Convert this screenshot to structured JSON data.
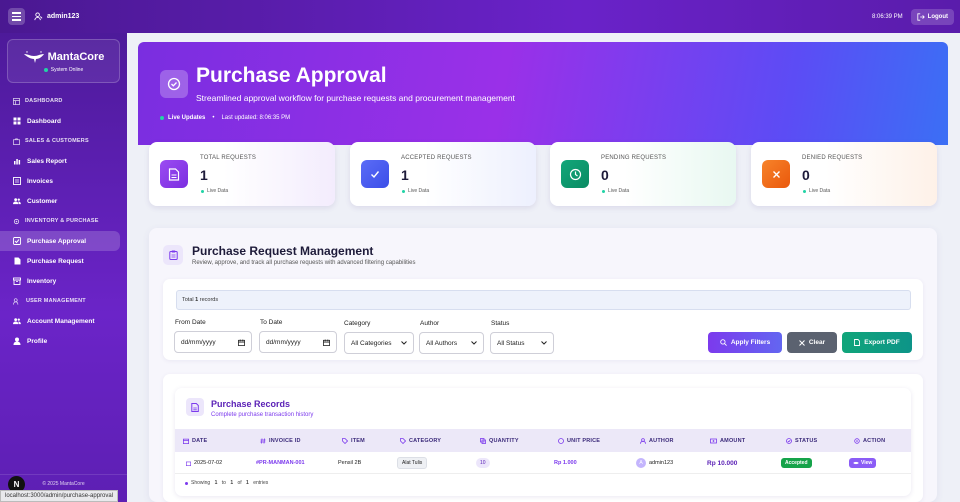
{
  "topbar": {
    "username": "admin123",
    "time": "8:06:39 PM",
    "logout_label": "Logout"
  },
  "sidebar": {
    "brand": "MantaCore",
    "system_status": "System Online",
    "sections": [
      {
        "title": "DASHBOARD",
        "items": [
          {
            "label": "Dashboard",
            "icon": "dashboard-icon"
          }
        ]
      },
      {
        "title": "SALES & CUSTOMERS",
        "items": [
          {
            "label": "Sales Report",
            "icon": "chart-icon"
          },
          {
            "label": "Invoices",
            "icon": "invoice-icon"
          },
          {
            "label": "Customer",
            "icon": "users-icon"
          }
        ]
      },
      {
        "title": "INVENTORY & PURCHASE",
        "items": [
          {
            "label": "Purchase Approval",
            "icon": "check-square-icon"
          },
          {
            "label": "Purchase Request",
            "icon": "file-icon"
          },
          {
            "label": "Inventory",
            "icon": "box-icon"
          }
        ]
      },
      {
        "title": "USER MANAGEMENT",
        "items": [
          {
            "label": "Account Management",
            "icon": "users-icon"
          },
          {
            "label": "Profile",
            "icon": "user-icon"
          }
        ]
      }
    ],
    "active": "Purchase Approval",
    "copyright": "© 2025 MantaCore"
  },
  "hero": {
    "title": "Purchase Approval",
    "subtitle": "Streamlined approval workflow for purchase requests and procurement management",
    "live": "Live Updates",
    "updated": "Last updated: 8:06:35 PM"
  },
  "stats": [
    {
      "label": "TOTAL REQUESTS",
      "value": "1",
      "sub": "Live Data",
      "color": "#8b3cf0"
    },
    {
      "label": "ACCEPTED REQUESTS",
      "value": "1",
      "sub": "Live Data",
      "color": "#4f5ef5"
    },
    {
      "label": "PENDING REQUESTS",
      "value": "0",
      "sub": "Live Data",
      "color": "#0e9a6e"
    },
    {
      "label": "DENIED REQUESTS",
      "value": "0",
      "sub": "Live Data",
      "color": "#f06a1a"
    }
  ],
  "panel": {
    "title": "Purchase Request Management",
    "subtitle": "Review, approve, and track all purchase requests with advanced filtering capabilities",
    "total_prefix": "Total ",
    "total_count": "1",
    "total_suffix": " records"
  },
  "filters": {
    "from_label": "From Date",
    "from_value": "dd/mm/yyyy",
    "to_label": "To Date",
    "to_value": "dd/mm/yyyy",
    "category_label": "Category",
    "category_value": "All Categories",
    "author_label": "Author",
    "author_value": "All Authors",
    "status_label": "Status",
    "status_value": "All Status",
    "apply": "Apply Filters",
    "clear": "Clear",
    "export": "Export PDF"
  },
  "records": {
    "title": "Purchase Records",
    "subtitle": "Complete purchase transaction history",
    "columns": [
      "DATE",
      "INVOICE ID",
      "ITEM",
      "CATEGORY",
      "QUANTITY",
      "UNIT PRICE",
      "AUTHOR",
      "AMOUNT",
      "STATUS",
      "ACTION"
    ],
    "rows": [
      {
        "date": "2025-07-02",
        "invoice": "#PR-MANMAN-001",
        "item": "Pensil 2B",
        "category": "Alat Tulis",
        "quantity": "10",
        "unit_price": "Rp 1.000",
        "author_initial": "A",
        "author": "admin123",
        "amount": "Rp 10.000",
        "status": "Accepted",
        "action": "View"
      }
    ],
    "footer_prefix": "Showing ",
    "footer_from": "1",
    "footer_mid1": " to ",
    "footer_to": "1",
    "footer_mid2": " of ",
    "footer_total": "1",
    "footer_suffix": " entries"
  },
  "statusbar_url": "localhost:3000/admin/purchase-approval",
  "next_badge": "N"
}
